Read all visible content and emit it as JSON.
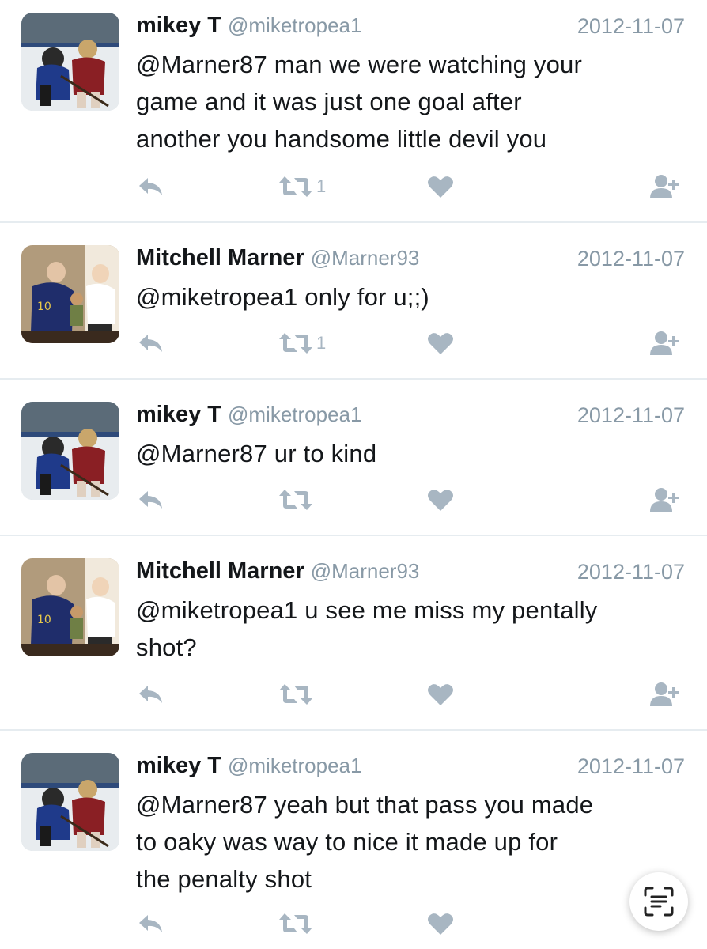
{
  "colors": {
    "name": "#14171a",
    "muted": "#8899a6",
    "action_icon": "#a8b6c2",
    "divider": "#e6ecf0"
  },
  "tweets": [
    {
      "name": "mikey T",
      "handle": "@miketropea1",
      "date": "2012-11-07",
      "lines": [
        "@Marner87 man we were watching your",
        "game and it was just one goal after",
        "another you handsome little devil you"
      ],
      "retweet_count": "1",
      "avatar_icon": "hockey-photo-avatar"
    },
    {
      "name": "Mitchell Marner",
      "handle": "@Marner93",
      "date": "2012-11-07",
      "lines": [
        "@miketropea1 only for u;;)"
      ],
      "retweet_count": "1",
      "avatar_icon": "family-photo-avatar"
    },
    {
      "name": "mikey T",
      "handle": "@miketropea1",
      "date": "2012-11-07",
      "lines": [
        "@Marner87 ur to kind"
      ],
      "retweet_count": "",
      "avatar_icon": "hockey-photo-avatar"
    },
    {
      "name": "Mitchell Marner",
      "handle": "@Marner93",
      "date": "2012-11-07",
      "lines": [
        "@miketropea1 u see me miss my pentally",
        "shot?"
      ],
      "retweet_count": "",
      "avatar_icon": "family-photo-avatar"
    },
    {
      "name": "mikey T",
      "handle": "@miketropea1",
      "date": "2012-11-07",
      "lines": [
        "@Marner87 yeah but that pass you made",
        "to oaky was way to nice it made up for",
        "the penalty shot"
      ],
      "retweet_count": "",
      "avatar_icon": "hockey-photo-avatar"
    }
  ],
  "icons": {
    "reply": "reply-icon",
    "retweet": "retweet-icon",
    "like": "heart-icon",
    "follow": "follow-user-icon",
    "scan": "live-text-scan-icon"
  }
}
